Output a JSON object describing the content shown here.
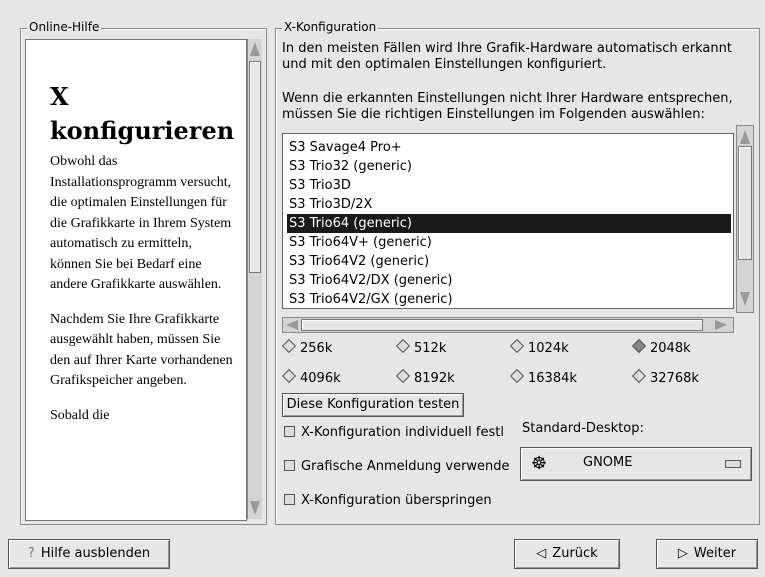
{
  "help": {
    "frame_title": "Online-Hilfe",
    "title_line1": "X",
    "title_line2": "konfigurieren",
    "para1": "Obwohl das Installationsprogramm versucht, die optimalen Einstellungen für die Grafikkarte in Ihrem System automatisch zu ermitteln, können Sie bei Bedarf eine andere Grafikkarte auswählen.",
    "para2": "Nachdem Sie Ihre Grafikkarte ausgewählt haben, müssen Sie den auf Ihrer Karte vorhandenen Grafikspeicher angeben.",
    "para3": "Sobald die"
  },
  "xconfig": {
    "frame_title": "X-Konfiguration",
    "desc1_line1": "In den meisten Fällen wird Ihre Grafik-Hardware automatisch erkannt",
    "desc1_line2": "und mit den optimalen Einstellungen konfiguriert.",
    "desc2_line1": "Wenn die erkannten Einstellungen nicht Ihrer Hardware entsprechen,",
    "desc2_line2": "müssen Sie die richtigen Einstellungen im Folgenden auswählen:",
    "cards": [
      "S3 Savage4 Pro+",
      "S3 Trio32 (generic)",
      "S3 Trio3D",
      "S3 Trio3D/2X",
      "S3 Trio64 (generic)",
      "S3 Trio64V+ (generic)",
      "S3 Trio64V2 (generic)",
      "S3 Trio64V2/DX (generic)",
      "S3 Trio64V2/GX (generic)"
    ],
    "selected_card": "S3 Trio64 (generic)",
    "memory_options": [
      "256k",
      "512k",
      "1024k",
      "2048k",
      "4096k",
      "8192k",
      "16384k",
      "32768k"
    ],
    "memory_selected": "2048k",
    "test_button": "Diese Konfiguration testen",
    "check_custom": "X-Konfiguration individuell festl",
    "check_graphical_login": "Grafische Anmeldung verwende",
    "check_skip": "X-Konfiguration überspringen",
    "desktop_label": "Standard-Desktop:",
    "desktop_value": "GNOME"
  },
  "footer": {
    "hide_help": "Hilfe ausblenden",
    "back": "Zurück",
    "next": "Weiter"
  }
}
